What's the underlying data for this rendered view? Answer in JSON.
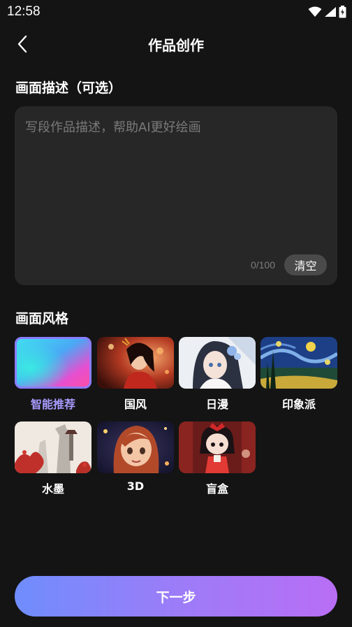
{
  "status_bar": {
    "time": "12:58"
  },
  "header": {
    "title": "作品创作"
  },
  "description": {
    "section_title": "画面描述（可选）",
    "placeholder": "写段作品描述，帮助AI更好绘画",
    "count": "0/100",
    "clear_label": "清空"
  },
  "style": {
    "section_title": "画面风格",
    "selected_index": 0,
    "items": [
      {
        "label": "智能推荐"
      },
      {
        "label": "国风"
      },
      {
        "label": "日漫"
      },
      {
        "label": "印象派"
      },
      {
        "label": "水墨"
      },
      {
        "label": "3D"
      },
      {
        "label": "盲盒"
      }
    ]
  },
  "footer": {
    "next_label": "下一步"
  },
  "colors": {
    "background": "#141414",
    "card": "#272727",
    "accent": "#8a7cff",
    "button_start": "#6f8dfd",
    "button_end": "#b86ef5"
  }
}
